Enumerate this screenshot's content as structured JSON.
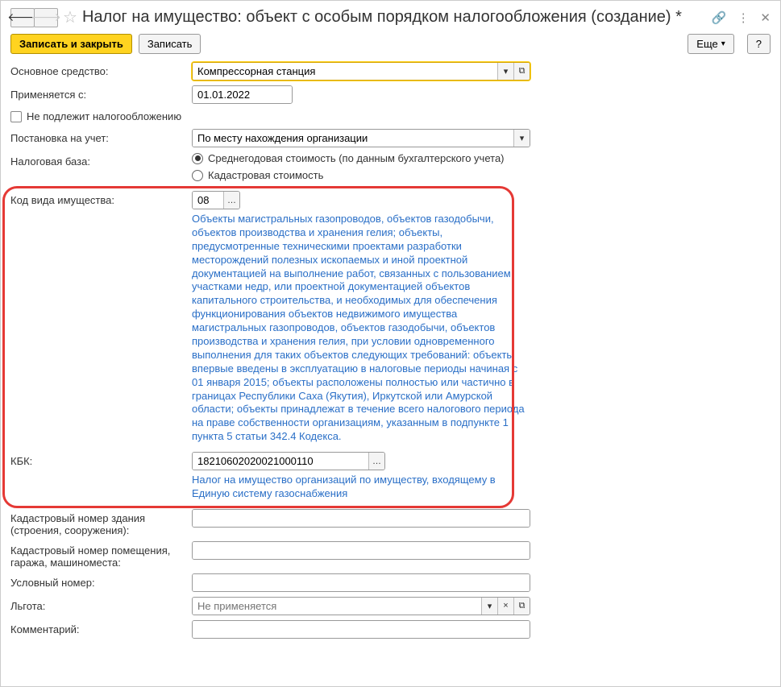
{
  "title": "Налог на имущество: объект с особым порядком налогообложения (создание) *",
  "toolbar": {
    "save_close": "Записать и закрыть",
    "save": "Записать",
    "more": "Еще",
    "help": "?"
  },
  "fields": {
    "fixed_asset_label": "Основное средство:",
    "fixed_asset_value": "Компрессорная станция",
    "applied_from_label": "Применяется с:",
    "applied_from_value": "01.01.2022",
    "not_taxable_label": "Не подлежит налогообложению",
    "registration_label": "Постановка на учет:",
    "registration_value": "По месту нахождения организации",
    "tax_base_label": "Налоговая база:",
    "tax_base_option1": "Среднегодовая стоимость (по данным бухгалтерского учета)",
    "tax_base_option2": "Кадастровая стоимость",
    "property_code_label": "Код вида имущества:",
    "property_code_value": "08",
    "property_code_desc": "Объекты магистральных газопроводов, объектов газодобычи, объектов производства и хранения гелия; объекты, предусмотренные техническими проектами разработки месторождений полезных ископаемых и иной проектной документацией на выполнение работ, связанных с пользованием участками недр, или проектной документацией объектов капитального строительства, и необходимых для обеспечения функционирования объектов недвижимого имущества магистральных газопроводов, объектов газодобычи, объектов производства и хранения гелия, при условии одновременного выполнения для таких объектов следующих требований: объекты впервые введены в эксплуатацию в налоговые периоды начиная с 01 января 2015; объекты расположены полностью или частично в границах Республики Саха (Якутия), Иркутской или Амурской области; объекты принадлежат в течение всего налогового периода на праве собственности организациям, указанным в подпункте 1 пункта 5 статьи 342.4 Кодекса.",
    "kbk_label": "КБК:",
    "kbk_value": "18210602020021000110",
    "kbk_desc": "Налог на имущество организаций по имуществу, входящему в Единую систему газоснабжения",
    "cadastral_building_label": "Кадастровый номер здания (строения, сооружения):",
    "cadastral_room_label": "Кадастровый номер помещения, гаража, машиноместа:",
    "conditional_number_label": "Условный номер:",
    "benefit_label": "Льгота:",
    "benefit_placeholder": "Не применяется",
    "comment_label": "Комментарий:"
  }
}
